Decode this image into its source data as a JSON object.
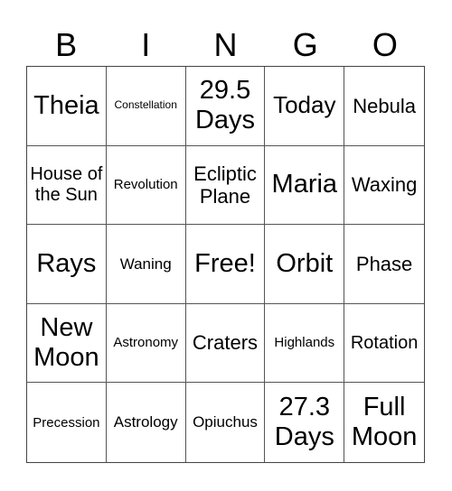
{
  "header": [
    "B",
    "I",
    "N",
    "G",
    "O"
  ],
  "cells": [
    "Theia",
    "Constellation",
    "29.5 Days",
    "Today",
    "Nebula",
    "House of the Sun",
    "Revolution",
    "Ecliptic Plane",
    "Maria",
    "Waxing",
    "Rays",
    "Waning",
    "Free!",
    "Orbit",
    "Phase",
    "New Moon",
    "Astronomy",
    "Craters",
    "Highlands",
    "Rotation",
    "Precession",
    "Astrology",
    "Opiuchus",
    "27.3 Days",
    "Full Moon"
  ]
}
